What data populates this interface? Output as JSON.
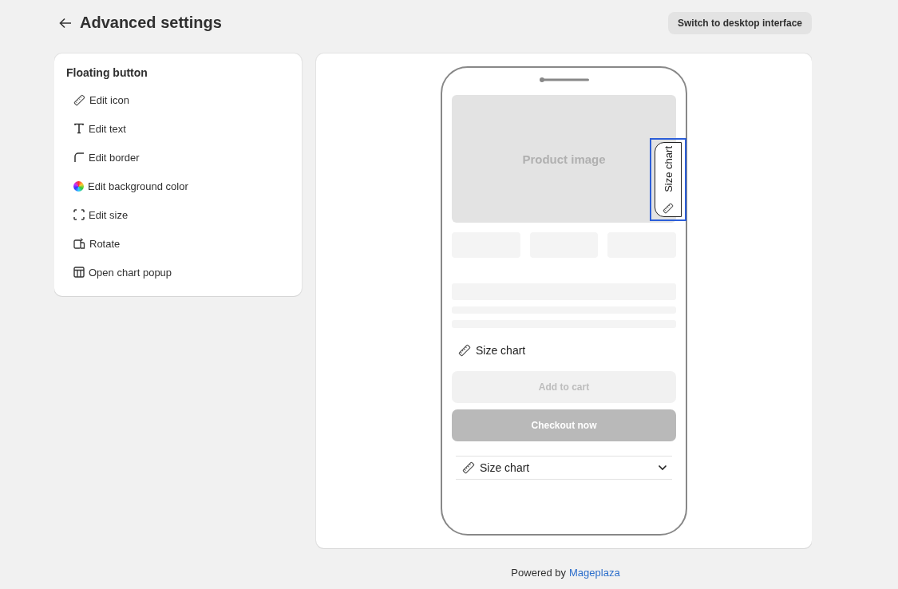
{
  "header": {
    "title": "Advanced settings",
    "action": "Switch to desktop interface"
  },
  "menu": {
    "title": "Floating button",
    "items": [
      {
        "label": "Edit icon"
      },
      {
        "label": "Edit text"
      },
      {
        "label": "Edit border"
      },
      {
        "label": "Edit background color"
      },
      {
        "label": "Edit size"
      },
      {
        "label": "Rotate"
      },
      {
        "label": "Open chart popup"
      }
    ]
  },
  "preview": {
    "image_label": "Product image",
    "floating_button": {
      "label": "Size chart",
      "selected": true
    },
    "inline_link": "Size chart",
    "add_to_cart": "Add to cart",
    "checkout": "Checkout now",
    "accordion": {
      "label": "Size chart",
      "expanded": false
    }
  },
  "footer": {
    "text": "Powered by",
    "link": "Mageplaza"
  }
}
